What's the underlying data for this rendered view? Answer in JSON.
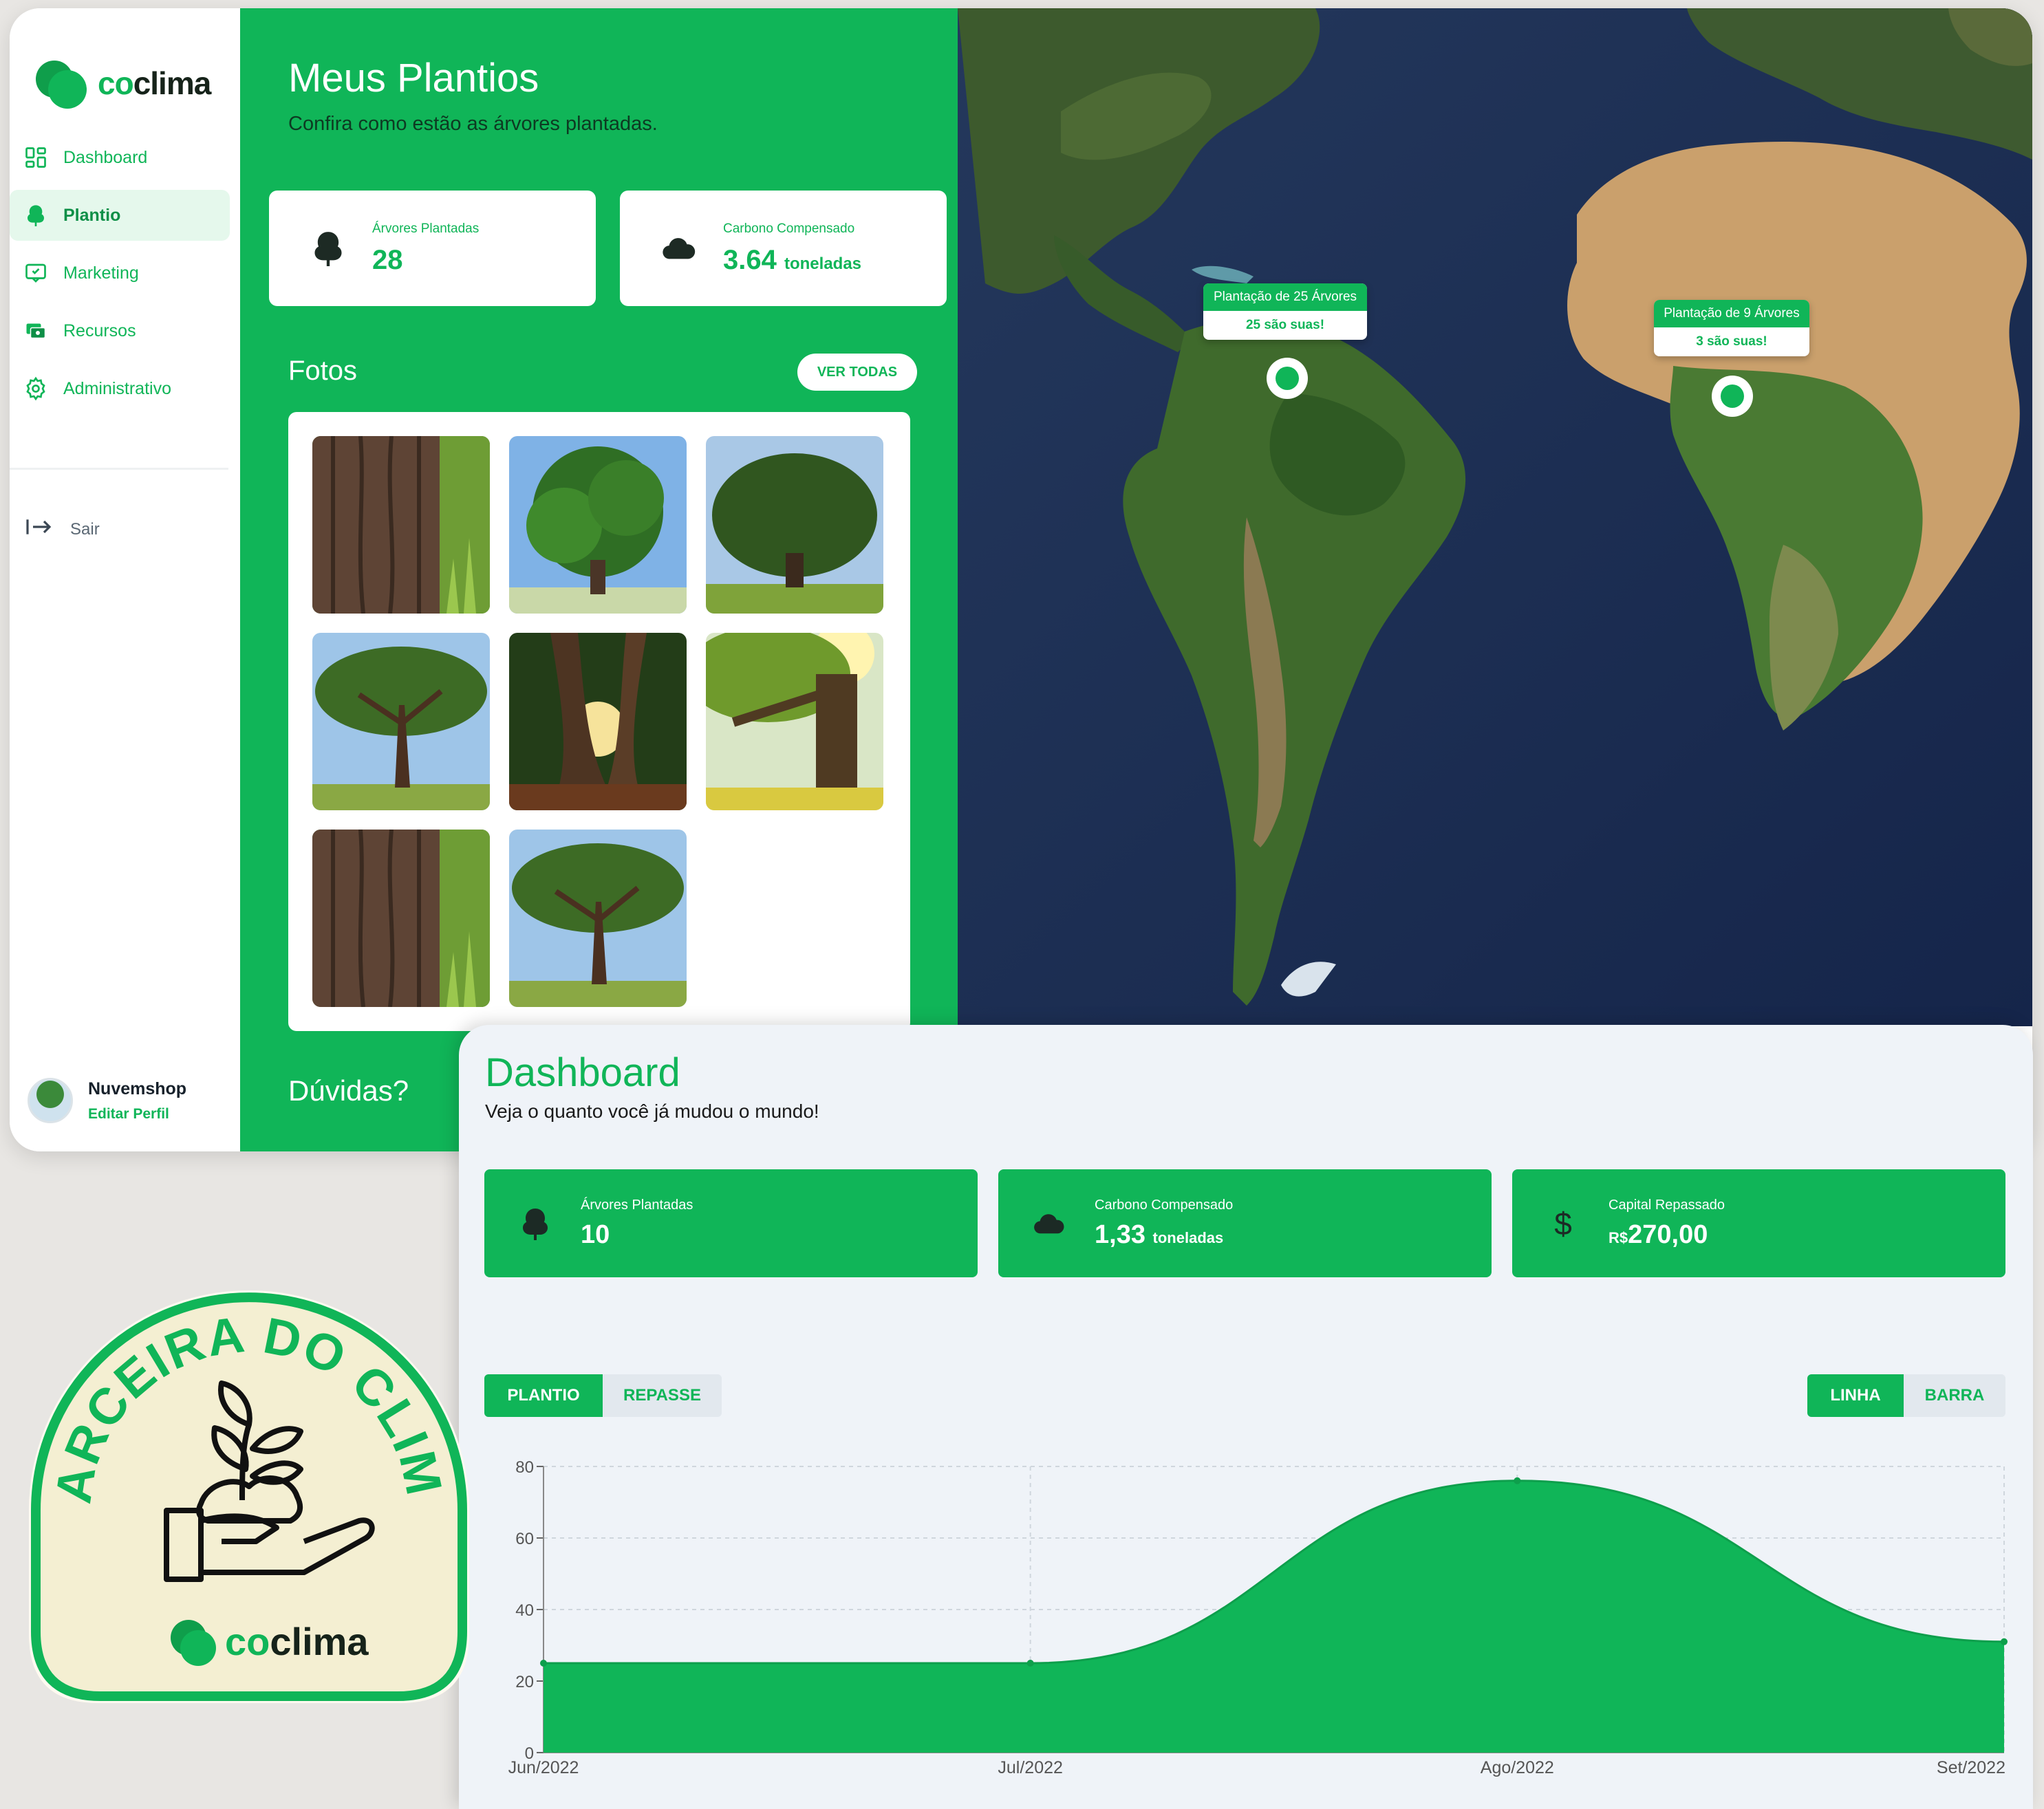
{
  "sidebar": {
    "logo_prefix": "co",
    "logo_suffix": "clima",
    "items": [
      {
        "label": "Dashboard",
        "icon": "grid-icon"
      },
      {
        "label": "Plantio",
        "icon": "tree-icon"
      },
      {
        "label": "Marketing",
        "icon": "chat-icon"
      },
      {
        "label": "Recursos",
        "icon": "money-icon"
      },
      {
        "label": "Administrativo",
        "icon": "gear-icon"
      }
    ],
    "active": "Plantio",
    "logout_label": "Sair",
    "profile": {
      "name": "Nuvemshop",
      "edit_label": "Editar Perfil"
    }
  },
  "plantios": {
    "title": "Meus Plantios",
    "subtitle": "Confira como estão as árvores plantadas.",
    "stats": [
      {
        "label": "Árvores Plantadas",
        "value": "28",
        "unit": ""
      },
      {
        "label": "Carbono Compensado",
        "value": "3.64",
        "unit": "toneladas"
      }
    ],
    "photos_title": "Fotos",
    "view_all_label": "VER TODAS",
    "photo_count": 8,
    "questions_label": "Dúvidas?"
  },
  "map": {
    "markers": [
      {
        "title": "Plantação de 25 Árvores",
        "subtitle": "25 são suas!"
      },
      {
        "title": "Plantação de 9 Árvores",
        "subtitle": "3 são suas!"
      }
    ]
  },
  "dashboard": {
    "title": "Dashboard",
    "subtitle": "Veja o quanto você já mudou o mundo!",
    "cards": [
      {
        "label": "Árvores Plantadas",
        "prefix": "",
        "value": "10",
        "unit": ""
      },
      {
        "label": "Carbono Compensado",
        "prefix": "",
        "value": "1,33",
        "unit": "toneladas"
      },
      {
        "label": "Capital Repassado",
        "prefix": "R$",
        "value": "270,00",
        "unit": ""
      }
    ],
    "dollar_symbol": "$",
    "tabs_left": [
      "PLANTIO",
      "REPASSE"
    ],
    "tabs_right": [
      "LINHA",
      "BARRA"
    ],
    "active_left": "PLANTIO",
    "active_right": "LINHA"
  },
  "chart_data": {
    "type": "area",
    "categories": [
      "Jun/2022",
      "Jul/2022",
      "Ago/2022",
      "Set/2022"
    ],
    "values": [
      25,
      25,
      76,
      31
    ],
    "ylim": [
      0,
      80
    ],
    "yticks": [
      "0",
      "20",
      "40",
      "60",
      "80"
    ],
    "grid": true,
    "color": "#10b558"
  },
  "badge": {
    "text": "PARCEIRA DO CLIMA",
    "logo_prefix": "co",
    "logo_suffix": "clima"
  },
  "colors": {
    "brand": "#10b558",
    "text_dark": "#16231a",
    "badge_bg": "#f5f0d6"
  }
}
